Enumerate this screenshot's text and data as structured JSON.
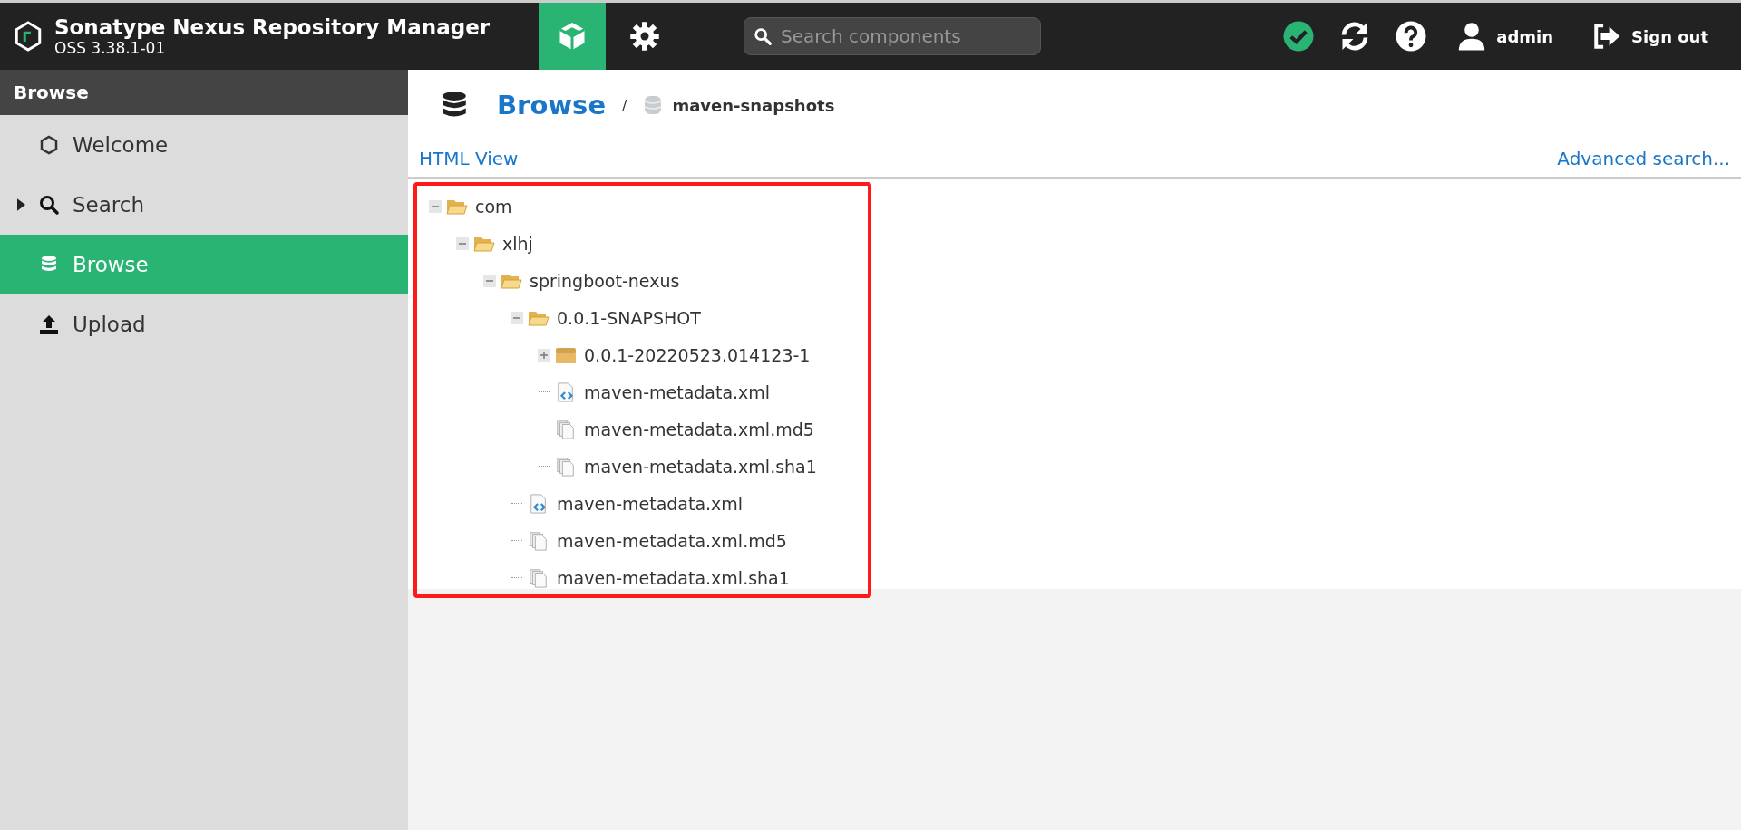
{
  "header": {
    "title": "Sonatype Nexus Repository Manager",
    "version": "OSS 3.38.1-01",
    "modes": [
      {
        "kind": "browse",
        "selected": true
      },
      {
        "kind": "admin",
        "selected": false
      }
    ],
    "search": {
      "placeholder": "Search components"
    },
    "user": "admin",
    "sign_out": "Sign out"
  },
  "sidebar": {
    "title": "Browse",
    "items": [
      {
        "label": "Welcome",
        "kind": "welcome",
        "selected": false,
        "expandable": false
      },
      {
        "label": "Search",
        "kind": "search",
        "selected": false,
        "expandable": true
      },
      {
        "label": "Browse",
        "kind": "browse",
        "selected": true,
        "expandable": false
      },
      {
        "label": "Upload",
        "kind": "upload",
        "selected": false,
        "expandable": false
      }
    ]
  },
  "breadcrumb": {
    "title": "Browse",
    "separator": "/",
    "repository": "maven-snapshots"
  },
  "links": {
    "html_view": "HTML View",
    "advanced_search": "Advanced search..."
  },
  "tree": [
    {
      "label": "com",
      "kind": "folder",
      "expanded": true,
      "children": [
        {
          "label": "xlhj",
          "kind": "folder",
          "expanded": true,
          "children": [
            {
              "label": "springboot-nexus",
              "kind": "folder",
              "expanded": true,
              "children": [
                {
                  "label": "0.0.1-SNAPSHOT",
                  "kind": "folder",
                  "expanded": true,
                  "children": [
                    {
                      "label": "0.0.1-20220523.014123-1",
                      "kind": "component",
                      "expanded": false
                    },
                    {
                      "label": "maven-metadata.xml",
                      "kind": "xml"
                    },
                    {
                      "label": "maven-metadata.xml.md5",
                      "kind": "file"
                    },
                    {
                      "label": "maven-metadata.xml.sha1",
                      "kind": "file"
                    }
                  ]
                },
                {
                  "label": "maven-metadata.xml",
                  "kind": "xml"
                },
                {
                  "label": "maven-metadata.xml.md5",
                  "kind": "file"
                },
                {
                  "label": "maven-metadata.xml.sha1",
                  "kind": "file"
                }
              ]
            }
          ]
        }
      ]
    }
  ]
}
